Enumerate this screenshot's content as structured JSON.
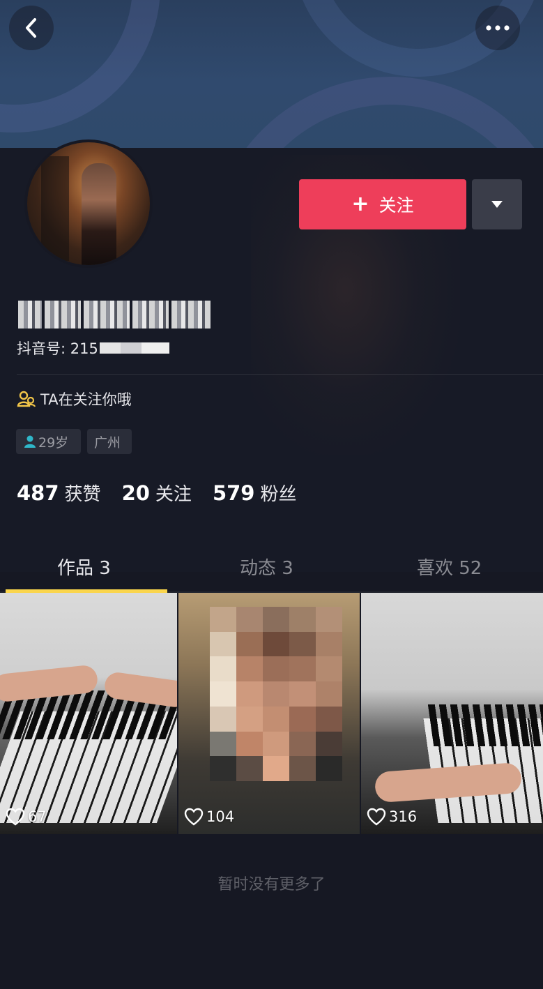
{
  "header": {
    "back_icon": "chevron-left-icon",
    "more_icon": "more-horizontal-icon"
  },
  "profile": {
    "follow_label": "关注",
    "douyin_id_prefix": "抖音号: 215",
    "follows_you_text": "TA在关注你哦",
    "age_tag": "29岁",
    "city_tag": "广州"
  },
  "stats": {
    "likes_count": "487",
    "likes_label": "获赞",
    "following_count": "20",
    "following_label": "关注",
    "followers_count": "579",
    "followers_label": "粉丝"
  },
  "tabs": [
    {
      "label": "作品 3",
      "active": true
    },
    {
      "label": "动态 3",
      "active": false
    },
    {
      "label": "喜欢 52",
      "active": false
    }
  ],
  "videos": [
    {
      "likes": "67"
    },
    {
      "likes": "104"
    },
    {
      "likes": "316"
    }
  ],
  "footer": {
    "no_more_text": "暂时没有更多了"
  },
  "colors": {
    "background": "#161823",
    "follow_button": "#ee3e5a",
    "tab_indicator": "#fad54c",
    "follows_you_icon": "#f2c649"
  }
}
